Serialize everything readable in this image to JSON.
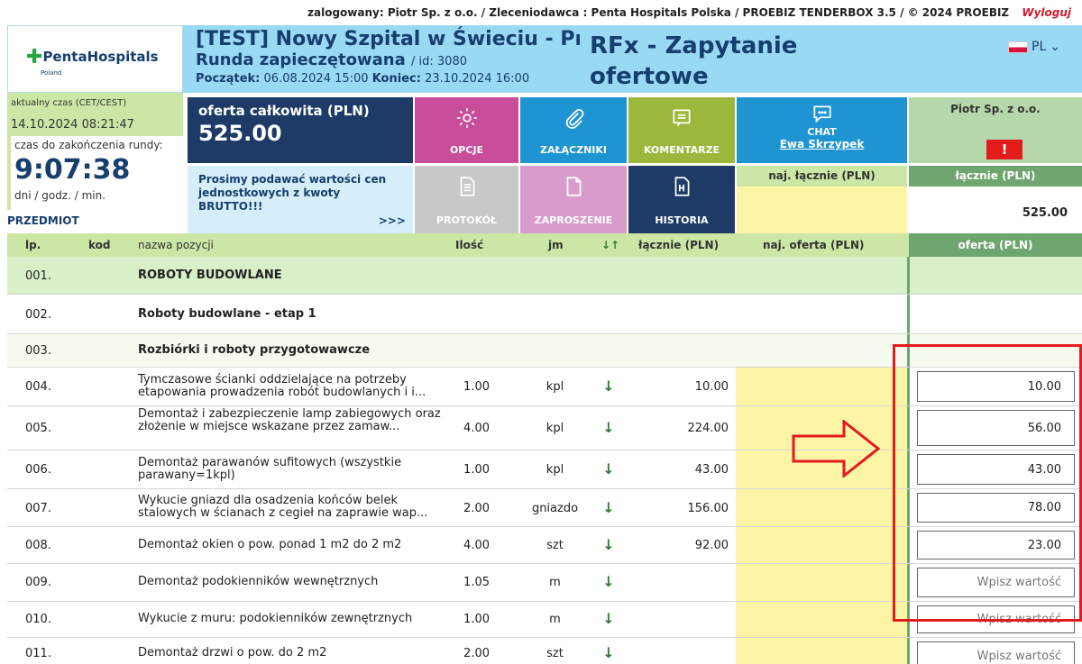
{
  "topbar": {
    "info": "zalogowany: Piotr Sp. z o.o. / Zleceniodawca : Penta Hospitals Polska / PROEBIZ TENDERBOX 3.5 / © 2024 PROEBIZ",
    "logout": "Wyloguj"
  },
  "logo": {
    "name": "PentaHospitals",
    "sub": "Poland"
  },
  "header": {
    "title": "[TEST] Nowy Szpital w Świeciu - Pr",
    "round": "Runda zapieczętowana",
    "id": "/ id: 3080",
    "start_label": "Początek:",
    "start": "06.08.2024 15:00",
    "end_label": "Koniec:",
    "end": "23.10.2024 16:00",
    "rfx": "RFx - Zapytanie ofertowe",
    "lang": "PL"
  },
  "time": {
    "current_label": "aktualny czas (CET/CEST)",
    "current": "14.10.2024 08:21:47",
    "remaining_label": "czas do zakończenia rundy:",
    "remaining": "9:07:38",
    "units": "dni  /  godz.  /  min."
  },
  "offer": {
    "label": "oferta całkowita (PLN)",
    "value": "525.00"
  },
  "notice": {
    "text": "Prosimy podawać wartości cen jednostkowych z kwoty BRUTTO!!!",
    "more": ">>>"
  },
  "tiles": {
    "opcje": "OPCJE",
    "zalaczniki": "ZAŁĄCZNIKI",
    "komentarze": "KOMENTARZE",
    "chat": "CHAT",
    "chat_user": "Ewa Skrzypek",
    "protokol": "PROTOKÓŁ",
    "zaproszenie": "ZAPROSZENIE",
    "historia": "HISTORIA"
  },
  "summary": {
    "best_total_label": "naj. łącznie (PLN)",
    "supplier": "Piotr Sp. z o.o.",
    "alert": "!",
    "total_label": "łącznie (PLN)",
    "total_value": "525.00"
  },
  "table": {
    "section_label": "PRZEDMIOT",
    "headers": {
      "lp": "lp.",
      "kod": "kod",
      "name": "nazwa pozycji",
      "qty": "Ilość",
      "unit": "jm",
      "sort": "↓↑",
      "total": "łącznie (PLN)",
      "best": "naj. oferta (PLN)",
      "offer": "oferta (PLN)"
    },
    "rows": [
      {
        "lp": "001.",
        "name": "ROBOTY BUDOWLANE"
      },
      {
        "lp": "002.",
        "name": "Roboty budowlane - etap 1"
      },
      {
        "lp": "003.",
        "name": "Rozbiórki i roboty przygotowawcze"
      },
      {
        "lp": "004.",
        "name": "Tymczasowe ścianki oddzielające na potrzeby etapowania prowadzenia robót budowlanych i i...",
        "qty": "1.00",
        "unit": "kpl",
        "total": "10.00",
        "offer": "10.00"
      },
      {
        "lp": "005.",
        "name": "Demontaż i zabezpieczenie lamp zabiegowych oraz złożenie w miejsce wskazane przez zamaw...",
        "qty": "4.00",
        "unit": "kpl",
        "total": "224.00",
        "offer": "56.00"
      },
      {
        "lp": "006.",
        "name": "Demontaż parawanów sufitowych (wszystkie parawany=1kpl)",
        "qty": "1.00",
        "unit": "kpl",
        "total": "43.00",
        "offer": "43.00"
      },
      {
        "lp": "007.",
        "name": "Wykucie gniazd dla osadzenia końców belek stalowych w ścianach z cegieł na zaprawie wap...",
        "qty": "2.00",
        "unit": "gniazdo",
        "total": "156.00",
        "offer": "78.00"
      },
      {
        "lp": "008.",
        "name": "Demontaż okien o pow. ponad 1 m2 do 2 m2",
        "qty": "4.00",
        "unit": "szt",
        "total": "92.00",
        "offer": "23.00"
      },
      {
        "lp": "009.",
        "name": "Demontaż podokienników wewnętrznych",
        "qty": "1.05",
        "unit": "m",
        "total": "",
        "offer": ""
      },
      {
        "lp": "010.",
        "name": "Wykucie z muru: podokienników zewnętrznych",
        "qty": "1.00",
        "unit": "m",
        "total": "",
        "offer": ""
      },
      {
        "lp": "011.",
        "name": "Demontaż drzwi o pow. do 2 m2",
        "qty": "2.00",
        "unit": "szt",
        "total": "",
        "offer": ""
      }
    ],
    "placeholder": "Wpisz wartość"
  },
  "colors": {
    "brand_dark": "#1d3b66",
    "header_blue": "#9ad9f4",
    "accent_green": "#6fa56f",
    "best_yellow": "#fdf5a6",
    "highlight_red": "#e21b1b"
  }
}
